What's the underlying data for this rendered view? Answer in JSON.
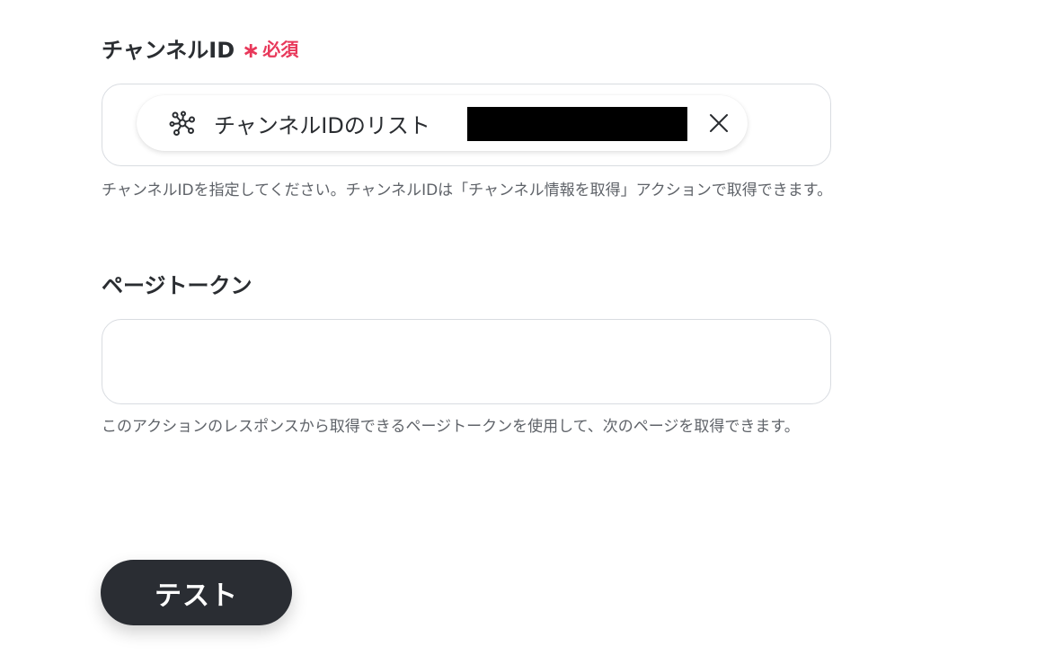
{
  "channel_id_field": {
    "label": "チャンネルID",
    "required_mark": "∗",
    "required_text": "必須",
    "chip": {
      "icon": "network-nodes-icon",
      "label": "チャンネルIDのリスト",
      "close_icon": "close-icon"
    },
    "help": "チャンネルIDを指定してください。チャンネルIDは「チャンネル情報を取得」アクションで取得できます。"
  },
  "page_token_field": {
    "label": "ページトークン",
    "value": "",
    "help": "このアクションのレスポンスから取得できるページトークンを使用して、次のページを取得できます。"
  },
  "test_button": {
    "label": "テスト"
  },
  "colors": {
    "required": "#e8385a",
    "button_bg": "#2a2d33",
    "border": "#d9dce1"
  }
}
